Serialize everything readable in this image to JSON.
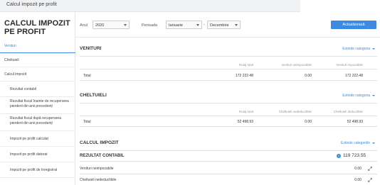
{
  "app": {
    "window_title": "Calcul impozit pe profit"
  },
  "sidebar": {
    "title": "CALCUL IMPOZIT PE PROFIT",
    "items": [
      {
        "label": "Venituri",
        "active": true,
        "level": "top"
      },
      {
        "label": "Cheltuieli",
        "level": "top"
      },
      {
        "label": "Calcul impozit",
        "level": "top"
      },
      {
        "label": "Rezultat contabil",
        "level": "sub"
      },
      {
        "label": "Rezultat fiscal înainte de recuperarea pierderii din anii precedenți",
        "level": "sub"
      },
      {
        "label": "Rezultat fiscal după recuperarea pierderii din anii precedenți",
        "level": "sub"
      },
      {
        "label": "Impozit pe profit calculat",
        "level": "sub"
      },
      {
        "label": "Impozit pe profit datorat",
        "level": "sub"
      },
      {
        "label": "Impozit pe profit de înregistrat",
        "level": "sub"
      }
    ]
  },
  "filters": {
    "year_label": "Anul",
    "year_value": "2020",
    "period_label": "Perioada",
    "period_from": "Ianuarie",
    "period_separator": "-",
    "period_to": "Decembrie",
    "update_button": "Actualizează"
  },
  "venituri": {
    "title": "VENITURI",
    "extend_label": "Extinde categoria",
    "columns": [
      "Rulaj total",
      "Venituri neimpozabile",
      "Venituri impozabile"
    ],
    "total_label": "Total",
    "total_values": [
      "172 222.48",
      "0.00",
      "172 222.48"
    ]
  },
  "cheltuieli": {
    "title": "CHELTUIELI",
    "extend_label": "Extinde categoria",
    "columns": [
      "Rulaj total",
      "Cheltuieli nedeductibile",
      "Cheltuieli deductibile"
    ],
    "total_label": "Total",
    "total_values": [
      "52 498.93",
      "0.00",
      "52 498.93"
    ]
  },
  "calcul": {
    "title": "CALCUL IMPOZIT",
    "extend_label": "Extinde categoriile",
    "rezultat_contabil_label": "REZULTAT CONTABIL",
    "rezultat_contabil_value": "119 723.55",
    "rows": [
      {
        "label": "Venituri neimpozabile",
        "value": "0.00"
      },
      {
        "label": "Cheltuieli nedeductibile",
        "value": "0.00"
      }
    ]
  },
  "colors": {
    "accent": "#3d8be0",
    "text": "#333333",
    "border": "#dfe1e5"
  },
  "icons": [
    "caret-down-icon",
    "chevron-down-icon",
    "info-icon",
    "expand-icon"
  ]
}
